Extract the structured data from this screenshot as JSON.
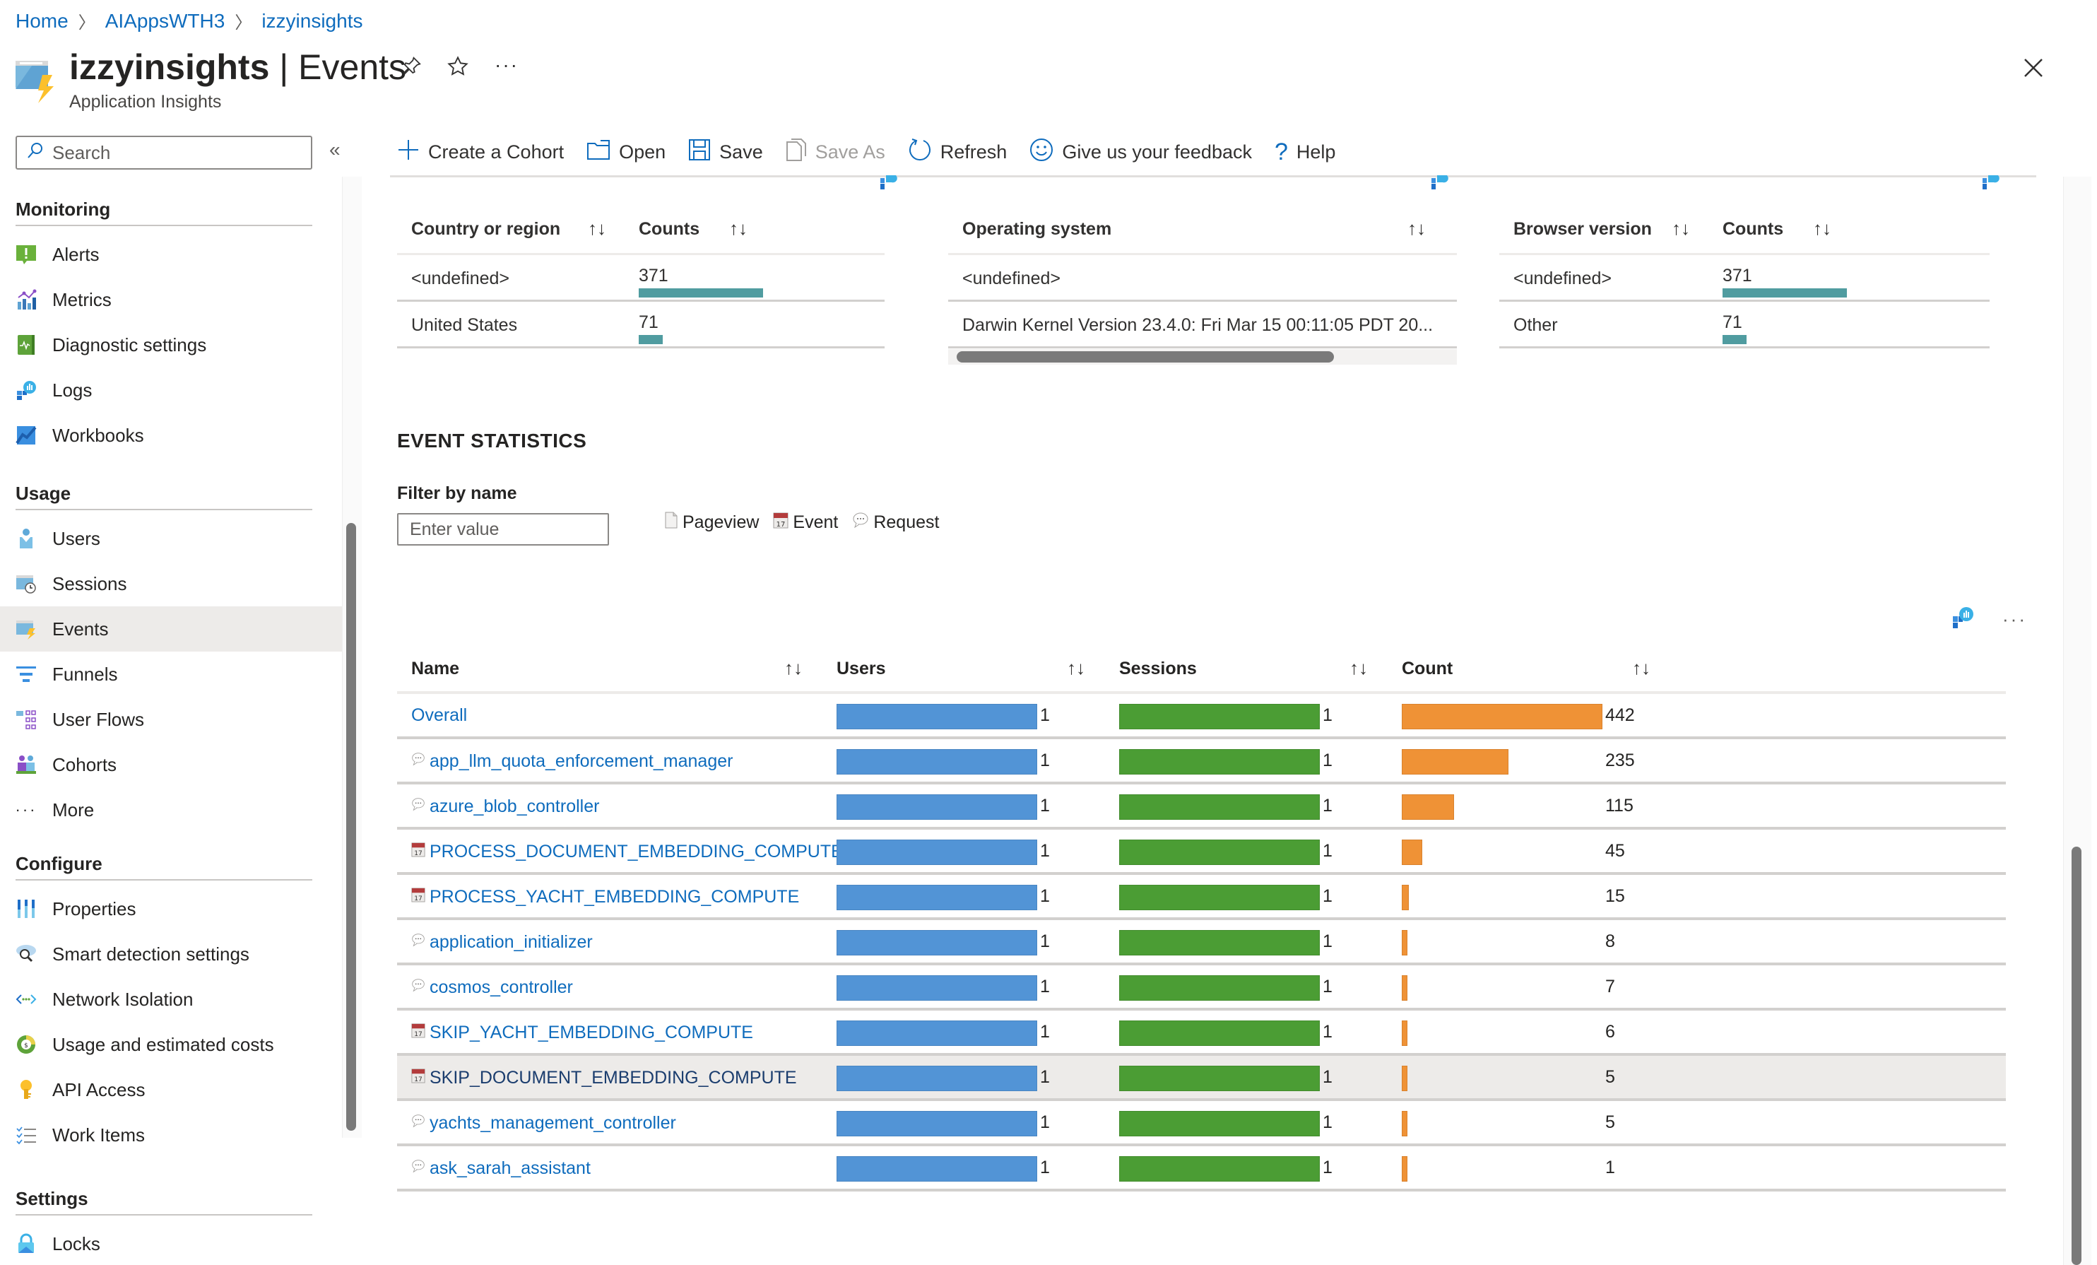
{
  "breadcrumb": [
    {
      "label": "Home"
    },
    {
      "label": "AIAppsWTH3"
    },
    {
      "label": "izzyinsights"
    }
  ],
  "header": {
    "resource_name": "izzyinsights",
    "separator": " | ",
    "page_name": "Events",
    "subtitle": "Application Insights",
    "icons": [
      "pin-icon",
      "star-icon",
      "more-icon",
      "close-icon"
    ]
  },
  "sidebar": {
    "search_placeholder": "Search",
    "collapse_label": "«",
    "sections": [
      {
        "title": "Monitoring",
        "items": [
          {
            "label": "Alerts",
            "icon": "alerts-icon"
          },
          {
            "label": "Metrics",
            "icon": "metrics-icon"
          },
          {
            "label": "Diagnostic settings",
            "icon": "diagnostic-settings-icon"
          },
          {
            "label": "Logs",
            "icon": "logs-icon"
          },
          {
            "label": "Workbooks",
            "icon": "workbooks-icon"
          }
        ]
      },
      {
        "title": "Usage",
        "items": [
          {
            "label": "Users",
            "icon": "users-icon"
          },
          {
            "label": "Sessions",
            "icon": "sessions-icon"
          },
          {
            "label": "Events",
            "icon": "events-icon",
            "active": true
          },
          {
            "label": "Funnels",
            "icon": "funnels-icon"
          },
          {
            "label": "User Flows",
            "icon": "user-flows-icon"
          },
          {
            "label": "Cohorts",
            "icon": "cohorts-icon"
          },
          {
            "label": "More",
            "icon": "more-icon"
          }
        ]
      },
      {
        "title": "Configure",
        "items": [
          {
            "label": "Properties",
            "icon": "properties-icon"
          },
          {
            "label": "Smart detection settings",
            "icon": "smart-detection-icon"
          },
          {
            "label": "Network Isolation",
            "icon": "network-isolation-icon"
          },
          {
            "label": "Usage and estimated costs",
            "icon": "usage-costs-icon"
          },
          {
            "label": "API Access",
            "icon": "api-key-icon"
          },
          {
            "label": "Work Items",
            "icon": "work-items-icon"
          }
        ]
      },
      {
        "title": "Settings",
        "items": [
          {
            "label": "Locks",
            "icon": "lock-icon"
          }
        ]
      }
    ]
  },
  "toolbar": {
    "create_cohort": "Create a Cohort",
    "open": "Open",
    "save": "Save",
    "save_as": "Save As",
    "refresh": "Refresh",
    "feedback": "Give us your feedback",
    "help": "Help"
  },
  "dimension_tables": {
    "country": {
      "headers": [
        "Country or region",
        "Counts"
      ],
      "rows": [
        {
          "label": "<undefined>",
          "count": 371
        },
        {
          "label": "United States",
          "count": 71
        }
      ]
    },
    "os": {
      "headers": [
        "Operating system"
      ],
      "rows": [
        {
          "label": "<undefined>"
        },
        {
          "label": "Darwin Kernel Version 23.4.0: Fri Mar 15 00:11:05 PDT 20..."
        }
      ]
    },
    "browser": {
      "headers": [
        "Browser version",
        "Counts"
      ],
      "rows": [
        {
          "label": "<undefined>",
          "count": 371
        },
        {
          "label": "Other",
          "count": 71
        }
      ]
    }
  },
  "event_statistics": {
    "title": "EVENT STATISTICS",
    "filter_label": "Filter by name",
    "filter_placeholder": "Enter value",
    "filter_value": "",
    "legend": [
      {
        "label": "Pageview",
        "icon": "pageview-icon"
      },
      {
        "label": "Event",
        "icon": "calendar-event-icon"
      },
      {
        "label": "Request",
        "icon": "request-bubble-icon"
      }
    ],
    "columns": [
      "Name",
      "Users",
      "Sessions",
      "Count"
    ],
    "max_count": 442,
    "rows": [
      {
        "name": "Overall",
        "type": "overall",
        "users": 1,
        "sessions": 1,
        "count": 442
      },
      {
        "name": "app_llm_quota_enforcement_manager",
        "type": "request",
        "users": 1,
        "sessions": 1,
        "count": 235
      },
      {
        "name": "azure_blob_controller",
        "type": "request",
        "users": 1,
        "sessions": 1,
        "count": 115
      },
      {
        "name": "PROCESS_DOCUMENT_EMBEDDING_COMPUTE",
        "type": "event",
        "users": 1,
        "sessions": 1,
        "count": 45
      },
      {
        "name": "PROCESS_YACHT_EMBEDDING_COMPUTE",
        "type": "event",
        "users": 1,
        "sessions": 1,
        "count": 15
      },
      {
        "name": "application_initializer",
        "type": "request",
        "users": 1,
        "sessions": 1,
        "count": 8
      },
      {
        "name": "cosmos_controller",
        "type": "request",
        "users": 1,
        "sessions": 1,
        "count": 7
      },
      {
        "name": "SKIP_YACHT_EMBEDDING_COMPUTE",
        "type": "event",
        "users": 1,
        "sessions": 1,
        "count": 6
      },
      {
        "name": "SKIP_DOCUMENT_EMBEDDING_COMPUTE",
        "type": "event",
        "users": 1,
        "sessions": 1,
        "count": 5,
        "highlighted": true
      },
      {
        "name": "yachts_management_controller",
        "type": "request",
        "users": 1,
        "sessions": 1,
        "count": 5
      },
      {
        "name": "ask_sarah_assistant",
        "type": "request",
        "users": 1,
        "sessions": 1,
        "count": 1
      }
    ]
  },
  "colors": {
    "link": "#0f6cbd",
    "users_bar": "#5294d6",
    "sessions_bar": "#4b9d34",
    "count_bar": "#ef9236",
    "dimension_bar": "#509ca0",
    "active_nav": "#edebe9"
  }
}
